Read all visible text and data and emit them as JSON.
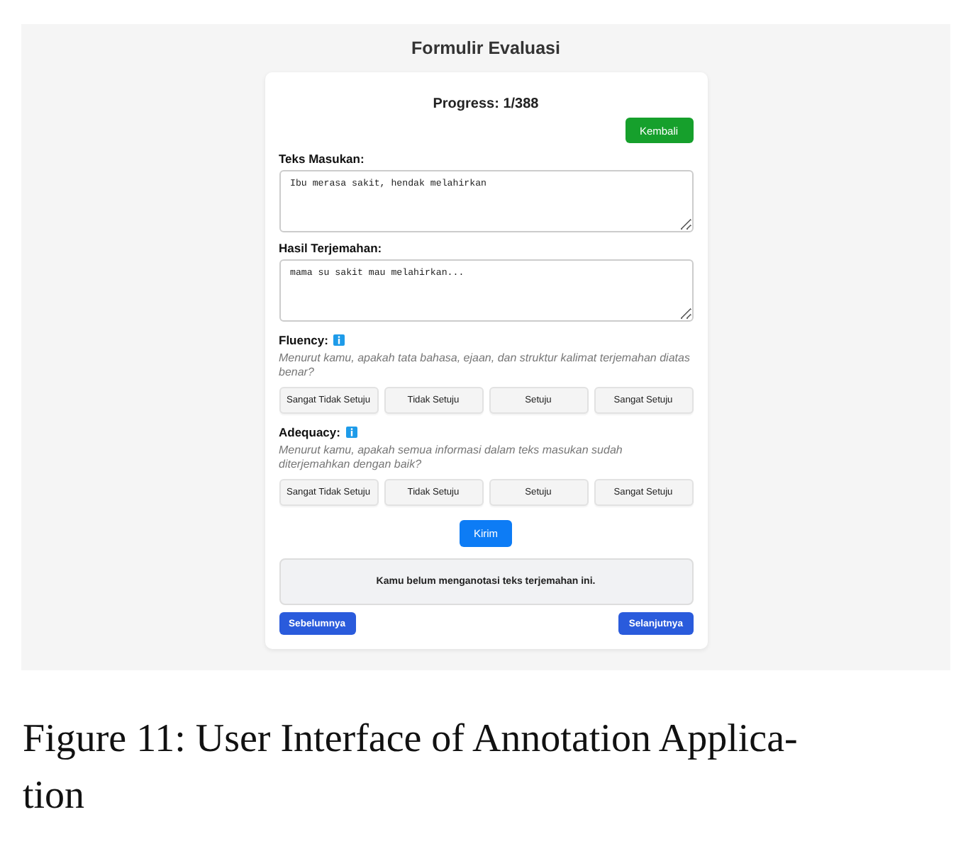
{
  "window": {
    "title": "Formulir Evaluasi"
  },
  "progress": "Progress: 1/388",
  "back_button": "Kembali",
  "fields": [
    {
      "label": "Teks Masukan:",
      "value": "Ibu merasa sakit, hendak melahirkan"
    },
    {
      "label": "Hasil Terjemahan:",
      "value": "mama su sakit mau melahirkan..."
    }
  ],
  "questions": [
    {
      "label": "Fluency:",
      "question": "Menurut kamu, apakah tata bahasa, ejaan, dan struktur kalimat terjemahan diatas benar?",
      "options": [
        {
          "label": "Sangat Tidak Setuju",
          "selected": false
        },
        {
          "label": "Tidak Setuju",
          "selected": false
        },
        {
          "label": "Setuju",
          "selected": false
        },
        {
          "label": "Sangat Setuju",
          "selected": false
        }
      ]
    },
    {
      "label": "Adequacy:",
      "question": "Menurut kamu, apakah semua informasi dalam teks masukan sudah diterjemahkan dengan baik?",
      "options": [
        {
          "label": "Sangat Tidak Setuju",
          "selected": false
        },
        {
          "label": "Tidak Setuju",
          "selected": false
        },
        {
          "label": "Setuju",
          "selected": false
        },
        {
          "label": "Sangat Setuju",
          "selected": false
        }
      ]
    }
  ],
  "submit_button": "Kirim",
  "status_message": "Kamu belum menganotasi teks terjemahan ini.",
  "nav_buttons": {
    "previous": "Sebelumnya",
    "next": "Selanjutnya"
  },
  "caption": {
    "lines": [
      "Figure 11: User Interface of Annotation Applica-",
      "tion"
    ]
  }
}
